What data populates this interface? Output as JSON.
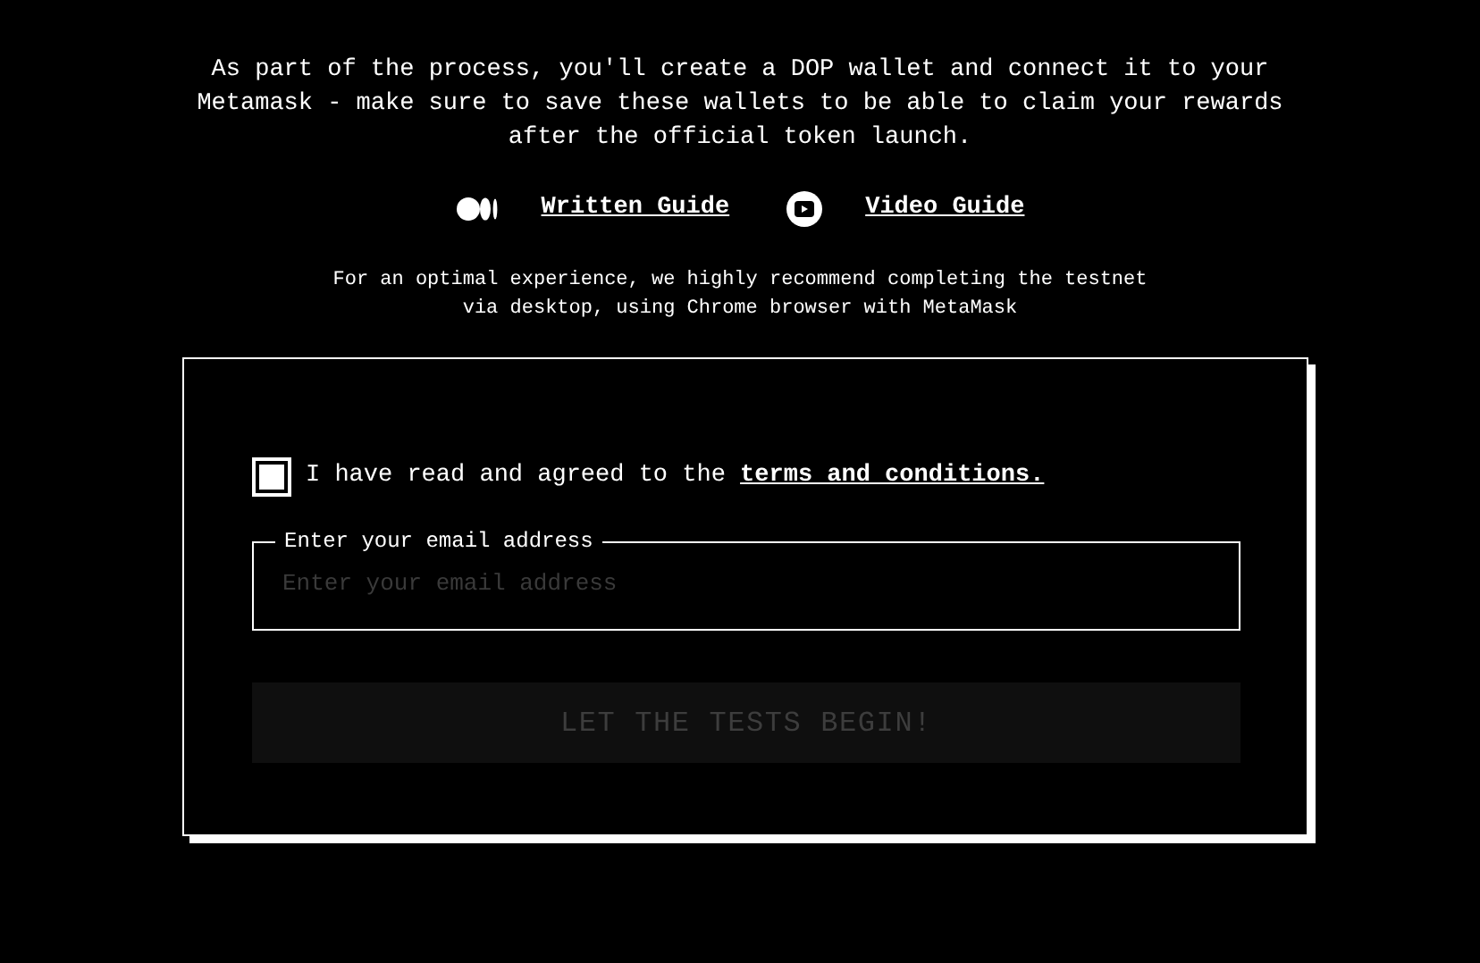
{
  "intro": "As part of the process, you'll create a DOP wallet and connect it to your Metamask - make sure to save these wallets to be able to claim your rewards after the official token launch.",
  "guides": [
    {
      "kind": "written",
      "label": "Written Guide"
    },
    {
      "kind": "video",
      "label": "Video Guide"
    }
  ],
  "recommendation": "For an optimal experience, we highly recommend completing the testnet via desktop, using Chrome browser with MetaMask",
  "form": {
    "agree": {
      "checked": false,
      "text": "I have read and agreed to the ",
      "link": "terms and conditions."
    },
    "email": {
      "label": "Enter your email address",
      "placeholder": "Enter your email address"
    },
    "submit": {
      "label": "LET THE TESTS BEGIN!",
      "disabled": true
    }
  }
}
